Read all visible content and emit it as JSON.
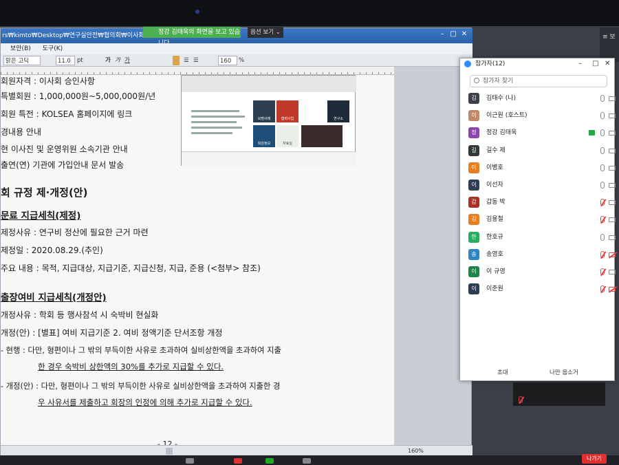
{
  "zoom": {
    "share_banner": "정강 김태욱의 화면을 보고 있습니다.",
    "view_options": "옵션 보기 ⌄",
    "leave_button": "나가기",
    "right_strip_label": "≡ 보"
  },
  "document_window": {
    "title": "rs₩kimto₩Desktop₩연구실안전₩협의회₩이사회₩2021095",
    "menus": [
      "보안(B)",
      "도구(K)"
    ],
    "toolbar": {
      "font": "맑은 고딕",
      "size": "11.0",
      "size_unit": "pt",
      "zoom": "160",
      "zoom_unit": "%"
    },
    "status_zoom": "160%",
    "page_number": "- 12 -"
  },
  "document": {
    "lines": [
      {
        "text": "회원자격 : 이사회 승인사항",
        "style": "normal"
      },
      {
        "text": "특별회원 : 1,000,000원~5,000,000원/년",
        "style": "normal"
      },
      {
        "text": "회원 특전 : KOLSEA 홈페이지에 링크",
        "style": "normal"
      },
      {
        "text": "경내용 안내",
        "style": "normal"
      },
      {
        "text": "현 이사진 및 운영위원 소속기관 안내",
        "style": "normal"
      },
      {
        "text": "출연(연) 기관에 가입안내 문서 발송",
        "style": "normal"
      },
      {
        "text": "회 규정 제·개정(안)",
        "style": "h1"
      },
      {
        "text": "문료 지급세칙(제정)",
        "style": "h2"
      },
      {
        "text": "제정사유 : 연구비 정산에 필요한 근거 마련",
        "style": "normal"
      },
      {
        "text": "제정일 : 2020.08.29.(추인)",
        "style": "normal"
      },
      {
        "text": "주요 내용 : 목적, 지급대상, 지급기준, 지급신청, 지급, 준용 (<첨부> 참조)",
        "style": "normal"
      },
      {
        "text": "출장여비 지급세칙(개정안)",
        "style": "h2"
      },
      {
        "text": "개정사유 : 학회 등 행사참석 시 숙박비 현실화",
        "style": "normal"
      },
      {
        "text": "개정(안) : [별표] 여비 지급기준 2. 여비 정액기준 단서조항 개정",
        "style": "normal"
      },
      {
        "text": "- 현행 : 다만, 형편이나 그 밖의 부득이한 사유로 초과하여 실비상한액을 초과하여 지출",
        "style": "normal"
      },
      {
        "text": "한 경우 숙박비 상한액의 30%를 추가로 지급할 수 있다.",
        "style": "underline"
      },
      {
        "text": "- 개정(안) : 다만, 형편이나 그 밖의 부득이한 사유로 실비상한액을 초과하여 지출한 경",
        "style": "normal"
      },
      {
        "text": "우 사유서를 제출하고 회장의 인정에 의해 추가로 지급할 수 있다.",
        "style": "underline"
      }
    ],
    "thumbnail_tiles": [
      "모범사례",
      "협력사업",
      "연구소",
      "회원정보",
      "자료실"
    ]
  },
  "participants": {
    "title": "참가자(12)",
    "search_placeholder": "참가자 찾기",
    "invite_label": "초대",
    "mute_all_label": "나만 음소거",
    "list": [
      {
        "initial": "김",
        "name": "김태수 (나)",
        "color": "#3a3f48",
        "mic": "on",
        "cam": "on",
        "share": false
      },
      {
        "initial": "이",
        "name": "이근원 (호스트)",
        "color": "#c08a6a",
        "mic": "on",
        "cam": "on",
        "share": false
      },
      {
        "initial": "정",
        "name": "정강 김태욱",
        "color": "#8e44ad",
        "mic": "on",
        "cam": "on",
        "share": true
      },
      {
        "initial": "길",
        "name": "길수 제",
        "color": "#2f3a33",
        "mic": "on",
        "cam": "on",
        "share": false
      },
      {
        "initial": "이",
        "name": "이병호",
        "color": "#e67e22",
        "mic": "on",
        "cam": "on",
        "share": false
      },
      {
        "initial": "이",
        "name": "이선자",
        "color": "#2c3e50",
        "mic": "on",
        "cam": "on",
        "share": false
      },
      {
        "initial": "갑",
        "name": "갑동 박",
        "color": "#a93226",
        "mic": "off",
        "cam": "on",
        "share": false
      },
      {
        "initial": "김",
        "name": "김용철",
        "color": "#e67e22",
        "mic": "off",
        "cam": "on",
        "share": false
      },
      {
        "initial": "한",
        "name": "한호규",
        "color": "#27ae60",
        "mic": "on",
        "cam": "on",
        "share": false
      },
      {
        "initial": "송",
        "name": "송영호",
        "color": "#2e86c1",
        "mic": "off",
        "cam": "off",
        "share": false
      },
      {
        "initial": "이",
        "name": "이 규영",
        "color": "#1e8449",
        "mic": "off",
        "cam": "on",
        "share": false
      },
      {
        "initial": "이",
        "name": "이준원",
        "color": "#2c3e50",
        "mic": "off",
        "cam": "off",
        "share": false
      }
    ]
  }
}
